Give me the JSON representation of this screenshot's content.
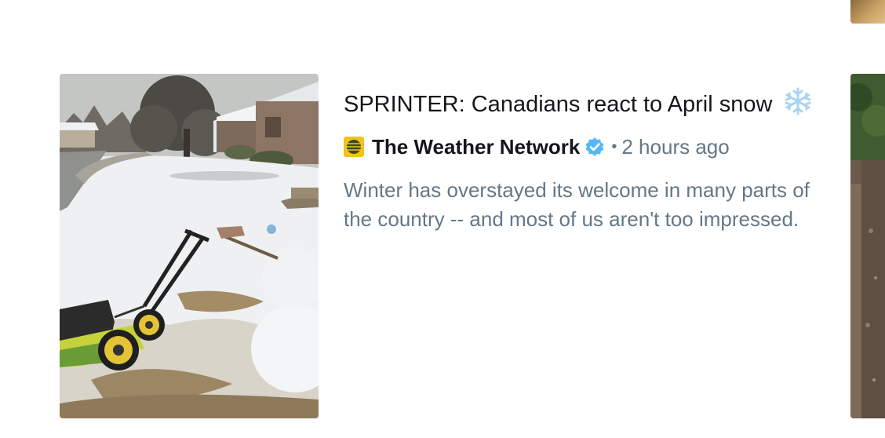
{
  "story": {
    "headline": "SPRINTER: Canadians react to April snow",
    "headline_emoji": "snowflake-emoji",
    "source": {
      "name": "The Weather Network",
      "logo_icon": "weather-network-logo",
      "verified": true
    },
    "separator": "•",
    "timestamp": "2 hours ago",
    "summary": "Winter has overstayed its welcome in many parts of the country -- and most of us aren't too impressed.",
    "thumbnail_icon": "snowman-lawnmower-photo"
  },
  "colors": {
    "headline": "#14171a",
    "meta": "#657786",
    "verified_badge": "#1da1f2",
    "snowflake": "#a8d4f2"
  }
}
